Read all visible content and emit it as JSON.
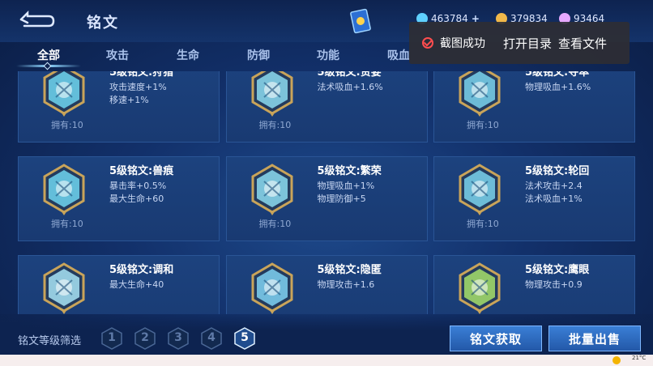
{
  "header": {
    "title": "铭文",
    "currencies": [
      {
        "name": "gem",
        "value": "463784",
        "color": "#5fd0ff"
      },
      {
        "name": "coin",
        "value": "379834",
        "color": "#f0b84a"
      },
      {
        "name": "crystal",
        "value": "93464",
        "color": "#e6a8ff"
      }
    ]
  },
  "tabs": [
    {
      "label": "全部",
      "active": true
    },
    {
      "label": "攻击",
      "active": false
    },
    {
      "label": "生命",
      "active": false
    },
    {
      "label": "防御",
      "active": false
    },
    {
      "label": "功能",
      "active": false
    },
    {
      "label": "吸血",
      "active": false
    }
  ],
  "toast": {
    "message": "截图成功",
    "open_folder": "打开目录",
    "view_file": "查看文件"
  },
  "runes": [
    {
      "name": "5级铭文:狩猎",
      "attrs": [
        "攻击速度+1%",
        "移速+1%"
      ],
      "owned": "拥有:10",
      "color": "#6fd6f0"
    },
    {
      "name": "5级铭文:贪婪",
      "attrs": [
        "法术吸血+1.6%"
      ],
      "owned": "拥有:10",
      "color": "#8cdcf0"
    },
    {
      "name": "5级铭文:夺萃",
      "attrs": [
        "物理吸血+1.6%"
      ],
      "owned": "拥有:10",
      "color": "#7ad4ec"
    },
    {
      "name": "5级铭文:兽痕",
      "attrs": [
        "暴击率+0.5%",
        "最大生命+60"
      ],
      "owned": "拥有:10",
      "color": "#6fd6f0"
    },
    {
      "name": "5级铭文:繁荣",
      "attrs": [
        "物理吸血+1%",
        "物理防御+5"
      ],
      "owned": "拥有:10",
      "color": "#8cdcf0"
    },
    {
      "name": "5级铭文:轮回",
      "attrs": [
        "法术攻击+2.4",
        "法术吸血+1%"
      ],
      "owned": "拥有:10",
      "color": "#7ad4ec"
    },
    {
      "name": "5级铭文:调和",
      "attrs": [
        "最大生命+40"
      ],
      "owned": "",
      "color": "#a8e4f4"
    },
    {
      "name": "5级铭文:隐匿",
      "attrs": [
        "物理攻击+1.6"
      ],
      "owned": "",
      "color": "#7fd2f2"
    },
    {
      "name": "5级铭文:鹰眼",
      "attrs": [
        "物理攻击+0.9"
      ],
      "owned": "",
      "color": "#a6e06a"
    }
  ],
  "footer": {
    "filter_label": "铭文等级筛选",
    "levels": [
      "1",
      "2",
      "3",
      "4",
      "5"
    ],
    "active_level": "5",
    "get_rune": "铭文获取",
    "bulk_sell": "批量出售"
  },
  "taskbar": {
    "temp": "21°C"
  }
}
